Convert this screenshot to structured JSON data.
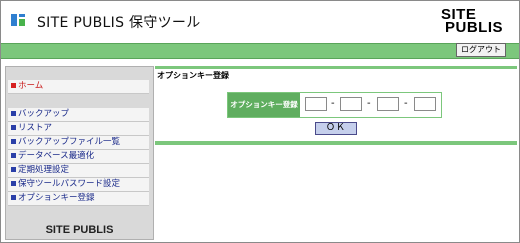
{
  "header": {
    "app_title": "SITE PUBLIS 保守ツール",
    "brand_line1": "SITE",
    "brand_line2": "PUBLIS"
  },
  "topbar": {
    "logout_label": "ログアウト"
  },
  "sidebar": {
    "items": [
      {
        "label": "ホーム"
      },
      {
        "label": "バックアップ"
      },
      {
        "label": "リストア"
      },
      {
        "label": "バックアップファイル一覧"
      },
      {
        "label": "データベース最適化"
      },
      {
        "label": "定期処理設定"
      },
      {
        "label": "保守ツールパスワード設定"
      },
      {
        "label": "オプションキー登録"
      }
    ],
    "brand": "SITE PUBLIS"
  },
  "main": {
    "heading": "オプションキー登録",
    "form_label": "オプションキー登録",
    "key_fields": [
      "",
      "",
      "",
      ""
    ],
    "separator": "-",
    "ok_label": "ＯＫ"
  },
  "colors": {
    "accent_green": "#7cc77c",
    "label_green": "#5fae5f",
    "nav_text": "#1a2a8a",
    "home_marker": "#d62020"
  }
}
